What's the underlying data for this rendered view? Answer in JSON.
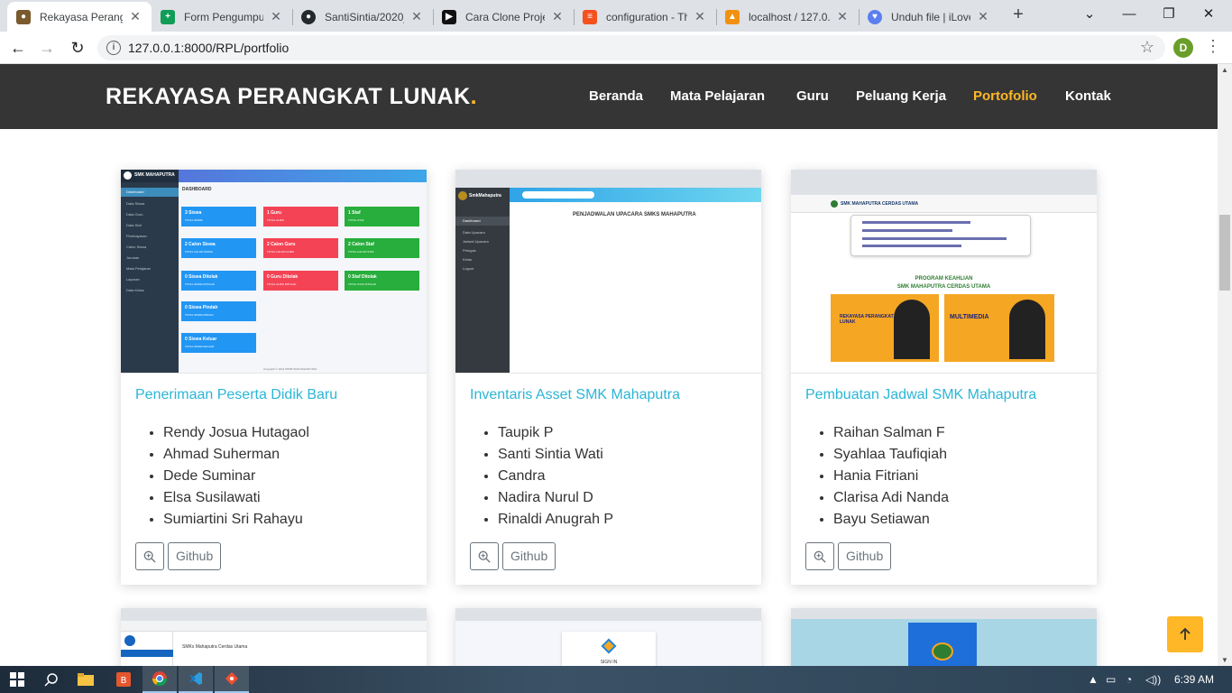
{
  "browser": {
    "tabs": [
      {
        "title": "Rekayasa Perangkat Lunak",
        "active": true
      },
      {
        "title": "Form Pengumpulan",
        "active": false
      },
      {
        "title": "SantiSintia/2020_",
        "active": false
      },
      {
        "title": "Cara Clone Project",
        "active": false
      },
      {
        "title": "configuration - Th",
        "active": false
      },
      {
        "title": "localhost / 127.0.0",
        "active": false
      },
      {
        "title": "Unduh file | iLove",
        "active": false
      }
    ],
    "new_tab_label": "+",
    "url": "127.0.0.1:8000/RPL/portfolio",
    "profile_initial": "D"
  },
  "site": {
    "brand": "REKAYASA PERANGKAT LUNAK",
    "brand_dot": ".",
    "menu": [
      {
        "label": "Beranda",
        "active": false
      },
      {
        "label": "Mata Pelajaran",
        "active": false
      },
      {
        "label": "Guru",
        "active": false
      },
      {
        "label": "Peluang Kerja",
        "active": false
      },
      {
        "label": "Portofolio",
        "active": true
      },
      {
        "label": "Kontak",
        "active": false
      }
    ],
    "accent_color": "#ffb727",
    "link_color": "#2cb5d6"
  },
  "portfolio": [
    {
      "title": "Penerimaan Peserta Didik Baru",
      "members": [
        "Rendy Josua Hutagaol",
        "Ahmad Suherman",
        "Dede Suminar",
        "Elsa Susilawati",
        "Sumiartini Sri Rahayu"
      ],
      "github_label": "Github",
      "preview": {
        "app": "SMK MAHAPUTRA",
        "heading": "DASHBOARD",
        "sidebar": [
          "Dashboard",
          "Data Siswa",
          "Data Guru",
          "Data Staf",
          "Pembayaran",
          "Calon Siswa",
          "Jurusan",
          "Mata Pelajaran",
          "Laporan",
          "Data Kelas"
        ],
        "tiles": [
          {
            "label": "3 Siswa",
            "sub": "TOTAL SISWA",
            "color": "#2196f3"
          },
          {
            "label": "1 Guru",
            "sub": "TOTAL GURU",
            "color": "#f44355"
          },
          {
            "label": "1 Staf",
            "sub": "TOTAL STAF",
            "color": "#27ae3c"
          },
          {
            "label": "2 Calon Siswa",
            "sub": "TOTAL CALON SISWA",
            "color": "#2196f3"
          },
          {
            "label": "2 Calon Guru",
            "sub": "TOTAL CALON GURU",
            "color": "#f44355"
          },
          {
            "label": "2 Calon Staf",
            "sub": "TOTAL CALON STAF",
            "color": "#27ae3c"
          },
          {
            "label": "0 Siswa Ditolak",
            "sub": "TOTAL SISWA DITOLAK",
            "color": "#2196f3"
          },
          {
            "label": "0 Guru Ditolak",
            "sub": "TOTAL GURU DITOLAK",
            "color": "#f44355"
          },
          {
            "label": "0 Staf Ditolak",
            "sub": "TOTAL STAF DITOLAK",
            "color": "#27ae3c"
          },
          {
            "label": "0 Siswa Pindah",
            "sub": "TOTAL SISWA PINDAH",
            "color": "#2196f3"
          },
          {
            "label": "0 Siswa Keluar",
            "sub": "TOTAL SISWA KELUAR",
            "color": "#2196f3"
          }
        ],
        "footer": "Copyright © 2021 PPDB SMK MAHAPUTRA"
      }
    },
    {
      "title": "Inventaris Asset SMK Mahaputra",
      "members": [
        "Taupik P",
        "Santi Sintia Wati",
        "Candra",
        "Nadira Nurul D",
        "Rinaldi Anugrah P"
      ],
      "github_label": "Github",
      "preview": {
        "app": "SmkMahaputra",
        "heading": "PENJADWALAN UPACARA SMKS MAHAPUTRA",
        "sidebar": [
          "Dashboard",
          "Data Upacara",
          "Jadwal Upacara",
          "Petugas",
          "Kelas",
          "Logout"
        ]
      }
    },
    {
      "title": "Pembuatan Jadwal SMK Mahaputra",
      "members": [
        "Raihan Salman F",
        "Syahlaa Taufiqiah",
        "Hania Fitriani",
        "Clarisa Adi Nanda",
        "Bayu Setiawan"
      ],
      "github_label": "Github",
      "preview": {
        "school": "SMK MAHAPUTRA CERDAS UTAMA",
        "program_heading": "PROGRAM KEAHLIAN",
        "program_school": "SMK MAHAPUTRA CERDAS UTAMA",
        "banner_left": "REKAYASA PERANGKAT LUNAK",
        "banner_right": "MULTIMEDIA"
      }
    }
  ],
  "next_row_previews": [
    {
      "caption": "SMKs Mahaputra Cerdas Utama"
    },
    {
      "caption": "SIGN IN"
    },
    {
      "caption": ""
    }
  ],
  "taskbar": {
    "time": "6:39 AM"
  }
}
